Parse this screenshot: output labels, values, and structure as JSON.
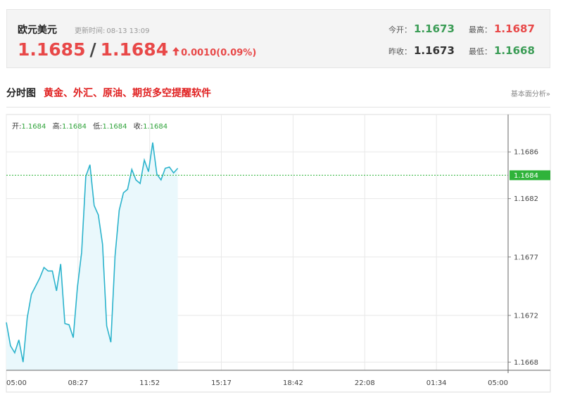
{
  "quote": {
    "name": "欧元美元",
    "update_label": "更新时间:",
    "update_time": "08-13 13:09",
    "bid": "1.1685",
    "separator": "/",
    "ask": "1.1684",
    "change": "0.0010(0.09%)",
    "open_label": "今开：",
    "open_value": "1.1673",
    "high_label": "最高：",
    "high_value": "1.1687",
    "prev_close_label": "昨收：",
    "prev_close_value": "1.1673",
    "low_label": "最低：",
    "low_value": "1.1668"
  },
  "section": {
    "title": "分时图",
    "promo": "黄金、外汇、原油、期货多空提醒软件",
    "link": "基本面分析»"
  },
  "colors": {
    "line": "#2bb3cc",
    "fill": "#eaf8fc",
    "current_price": "#2fb33a",
    "up": "#e84848",
    "down": "#3a9c55"
  },
  "chart_data": {
    "type": "line",
    "summary": {
      "open_label": "开:",
      "open": "1.1684",
      "high_label": "高:",
      "high": "1.1684",
      "low_label": "低:",
      "low": "1.1684",
      "close_label": "收:",
      "close": "1.1684"
    },
    "x_ticks": [
      "05:00",
      "08:27",
      "11:52",
      "15:17",
      "18:42",
      "22:08",
      "01:34",
      "05:00"
    ],
    "y_ticks": [
      "1.1686",
      "1.1682",
      "1.1677",
      "1.1672",
      "1.1668"
    ],
    "ylim": [
      1.16673,
      1.16892
    ],
    "current_price": 1.1684,
    "current_label": "1.1684",
    "x_minutes": [
      0,
      12,
      24,
      36,
      48,
      60,
      72,
      84,
      96,
      108,
      120,
      132,
      144,
      156,
      168,
      180,
      192,
      204,
      216,
      228,
      240,
      252,
      264,
      276,
      288,
      300,
      312,
      324,
      336,
      348,
      360,
      372,
      384,
      396,
      408,
      420,
      432,
      444,
      456,
      468,
      480,
      492
    ],
    "values": [
      1.16714,
      1.16694,
      1.16688,
      1.16699,
      1.1668,
      1.16718,
      1.16738,
      1.16745,
      1.16752,
      1.16761,
      1.16758,
      1.16758,
      1.16741,
      1.16764,
      1.16713,
      1.16712,
      1.16701,
      1.16744,
      1.16774,
      1.16839,
      1.16849,
      1.16814,
      1.16806,
      1.16781,
      1.16711,
      1.16697,
      1.16771,
      1.1681,
      1.16825,
      1.16828,
      1.16845,
      1.16836,
      1.16833,
      1.16853,
      1.16843,
      1.16868,
      1.16841,
      1.16836,
      1.16846,
      1.16847,
      1.16842,
      1.16846
    ]
  }
}
